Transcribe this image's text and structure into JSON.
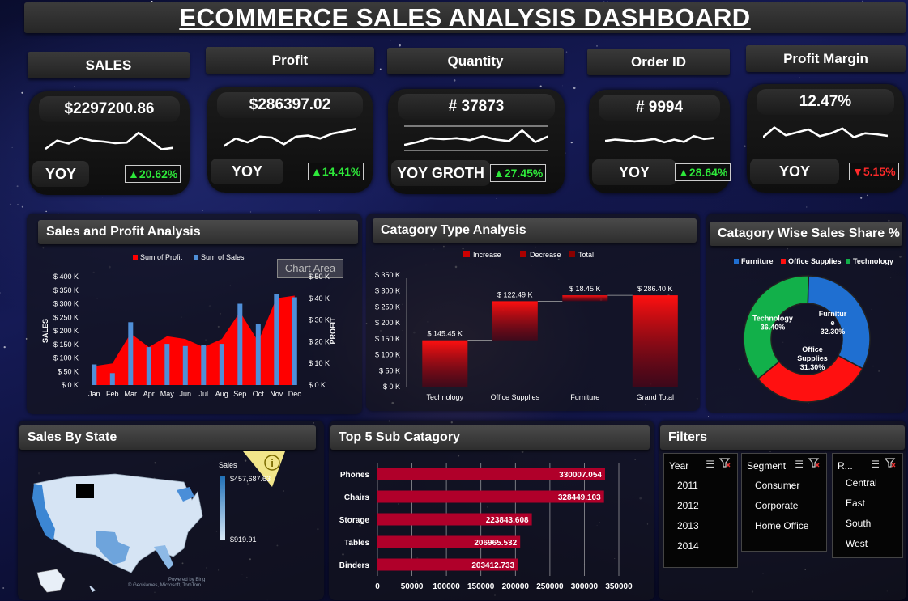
{
  "title": "ECOMMERCE SALES ANALYSIS DASHBOARD",
  "kpis": [
    {
      "label": "SALES",
      "value": "$2297200.86",
      "yoy_label": "YOY",
      "yoy": "20.62%",
      "dir": "up"
    },
    {
      "label": "Profit",
      "value": "$286397.02",
      "yoy_label": "YOY",
      "yoy": "14.41%",
      "dir": "up"
    },
    {
      "label": "Quantity",
      "value": "# 37873",
      "yoy_label": "YOY GROTH",
      "yoy": "27.45%",
      "dir": "up"
    },
    {
      "label": "Order ID",
      "value": "# 9994",
      "yoy_label": "YOY",
      "yoy": "28.64%",
      "dir": "up"
    },
    {
      "label": "Profit Margin",
      "value": "12.47%",
      "yoy_label": "YOY",
      "yoy": "5.15%",
      "dir": "down"
    }
  ],
  "arrows": {
    "up": "▲",
    "down": "▼"
  },
  "panels": {
    "sales_profit": "Sales and Profit Analysis",
    "category_type": "Catagory Type Analysis",
    "category_share": "Catagory Wise Sales Share %",
    "sales_by_state": "Sales By State",
    "top5": "Top 5 Sub Catagory",
    "filters": "Filters"
  },
  "chart_area_tooltip": "Chart Area",
  "colors": {
    "profit": "#ff0000",
    "sales": "#4f8fd8",
    "furniture": "#1f6fd1",
    "office": "#ff1010",
    "technology": "#12b04a",
    "bar": "#b0002a"
  },
  "chart_data": [
    {
      "type": "bar",
      "id": "sales_profit",
      "categories": [
        "Jan",
        "Feb",
        "Mar",
        "Apr",
        "May",
        "Jun",
        "Jul",
        "Aug",
        "Sep",
        "Oct",
        "Nov",
        "Dec"
      ],
      "series": [
        {
          "name": "Sum of Profit",
          "kind": "area",
          "axis": "left",
          "values": [
            70000,
            80000,
            190000,
            140000,
            180000,
            170000,
            140000,
            170000,
            270000,
            160000,
            320000,
            330000
          ]
        },
        {
          "name": "Sum of Sales",
          "kind": "bar",
          "axis": "right",
          "values": [
            9500,
            5500,
            29000,
            17500,
            19000,
            18000,
            18500,
            19000,
            37500,
            28000,
            42000,
            40500
          ]
        }
      ],
      "ylabel": "SALES",
      "y2label": "PROFIT",
      "ylim": [
        0,
        400000
      ],
      "y2lim": [
        0,
        50000
      ],
      "yticks": [
        "$ 0 K",
        "$ 50 K",
        "$ 100 K",
        "$ 150 K",
        "$ 200 K",
        "$ 250 K",
        "$ 300 K",
        "$ 350 K",
        "$ 400 K"
      ],
      "y2ticks": [
        "$ 0 K",
        "$ 10 K",
        "$ 20 K",
        "$ 30 K",
        "$ 40 K",
        "$ 50 K"
      ],
      "legend": "top"
    },
    {
      "type": "bar",
      "id": "category_type",
      "subtype": "waterfall",
      "legend_items": [
        "Increase",
        "Decrease",
        "Total"
      ],
      "categories": [
        "Technology",
        "Office Supplies",
        "Furniture",
        "Grand Total"
      ],
      "values": [
        145.45,
        122.49,
        18.45,
        286.4
      ],
      "data_labels": [
        "$ 145.45 K",
        "$ 122.49 K",
        "$ 18.45 K",
        "$ 286.40 K"
      ],
      "ylim": [
        0,
        350
      ],
      "yticks": [
        "$ 0 K",
        "$ 50 K",
        "$ 100 K",
        "$ 150 K",
        "$ 200 K",
        "$ 250 K",
        "$ 300 K",
        "$ 350 K"
      ]
    },
    {
      "type": "pie",
      "id": "category_share",
      "subtype": "donut",
      "legend_items": [
        "Furniture",
        "Office Supplies",
        "Technology"
      ],
      "values": [
        32.3,
        31.3,
        36.4
      ],
      "labels": [
        [
          "Furnitur",
          "e",
          "32.30%"
        ],
        [
          "Office",
          "Supplies",
          "31.30%"
        ],
        [
          "Technology",
          "36.40%"
        ]
      ],
      "legend": "top"
    },
    {
      "type": "bar",
      "id": "top5",
      "orientation": "horizontal",
      "categories": [
        "Phones",
        "Chairs",
        "Storage",
        "Tables",
        "Binders"
      ],
      "values": [
        330007.054,
        328449.103,
        223843.608,
        206965.532,
        203412.733
      ],
      "data_labels": [
        "330007.054",
        "328449.103",
        "223843.608",
        "206965.532",
        "203412.733"
      ],
      "xlim": [
        0,
        350000
      ],
      "xticks": [
        "0",
        "50000",
        "100000",
        "150000",
        "200000",
        "250000",
        "300000",
        "350000"
      ]
    }
  ],
  "map": {
    "legend_title": "Sales",
    "legend_max": "$457,687.63",
    "legend_min": "$919.91",
    "powered_by": "Powered by Bing",
    "credit": "© GeoNames, Microsoft, TomTom",
    "info_icon": "info-icon"
  },
  "slicers": [
    {
      "title": "Year",
      "items": [
        "2011",
        "2012",
        "2013",
        "2014"
      ]
    },
    {
      "title": "Segment",
      "items": [
        "Consumer",
        "Corporate",
        "Home Office"
      ]
    },
    {
      "title": "R...",
      "items": [
        "Central",
        "East",
        "South",
        "West"
      ]
    }
  ]
}
